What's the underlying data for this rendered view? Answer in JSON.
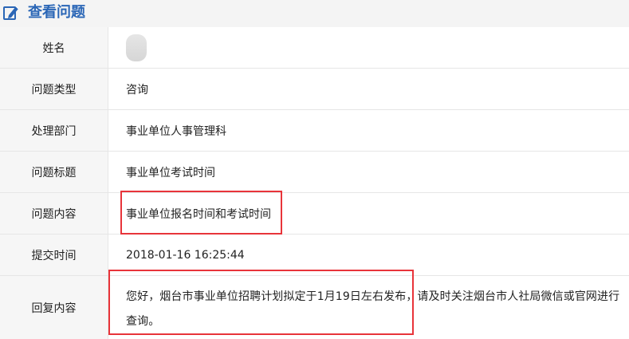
{
  "header": {
    "title": "查看问题",
    "icon": "edit-icon"
  },
  "fields": {
    "name": {
      "label": "姓名",
      "value": ""
    },
    "type": {
      "label": "问题类型",
      "value": "咨询"
    },
    "dept": {
      "label": "处理部门",
      "value": "事业单位人事管理科"
    },
    "subject": {
      "label": "问题标题",
      "value": "事业单位考试时间"
    },
    "content": {
      "label": "问题内容",
      "value": "事业单位报名时间和考试时间"
    },
    "time": {
      "label": "提交时间",
      "value": "2018-01-16 16:25:44"
    },
    "reply": {
      "label": "回复内容",
      "value": "您好，烟台市事业单位招聘计划拟定于1月19日左右发布，请及时关注烟台市人社局微信或官网进行查询。"
    }
  },
  "colors": {
    "title": "#2a66b6",
    "highlight": "#e8343a",
    "label_bg": "#f6f6f6"
  }
}
